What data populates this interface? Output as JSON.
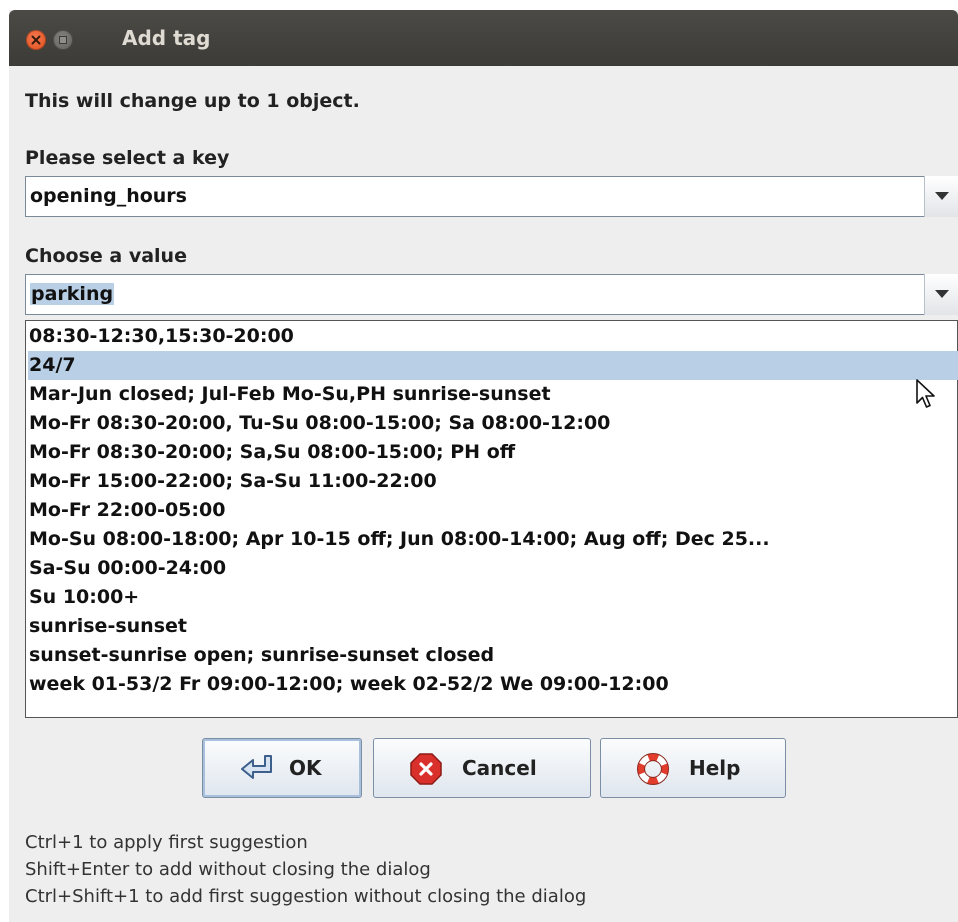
{
  "window": {
    "title": "Add tag"
  },
  "info_text": "This will change up to 1 object.",
  "key_section": {
    "label": "Please select a key",
    "value": "opening_hours"
  },
  "value_section": {
    "label": "Choose a value",
    "value": "parking"
  },
  "suggestions": [
    "08:30-12:30,15:30-20:00",
    "24/7",
    "Mar-Jun closed; Jul-Feb Mo-Su,PH sunrise-sunset",
    "Mo-Fr 08:30-20:00, Tu-Su 08:00-15:00; Sa 08:00-12:00",
    "Mo-Fr 08:30-20:00; Sa,Su 08:00-15:00; PH off",
    "Mo-Fr 15:00-22:00; Sa-Su 11:00-22:00",
    "Mo-Fr 22:00-05:00",
    "Mo-Su 08:00-18:00; Apr 10-15 off; Jun 08:00-14:00; Aug off; Dec 25...",
    "Sa-Su 00:00-24:00",
    "Su 10:00+",
    "sunrise-sunset",
    "sunset-sunrise open; sunrise-sunset closed",
    "week 01-53/2 Fr 09:00-12:00; week 02-52/2 We 09:00-12:00"
  ],
  "highlighted_suggestion": "24/7",
  "buttons": {
    "ok": "OK",
    "cancel": "Cancel",
    "help": "Help"
  },
  "icons": {
    "ok": "return-arrow-icon",
    "cancel": "stop-sign-icon",
    "help": "lifebuoy-icon",
    "combo_arrow": "triangle-down-icon"
  },
  "hints": [
    "Ctrl+1 to apply first suggestion",
    "Shift+Enter to add without closing the dialog",
    "Ctrl+Shift+1 to add first suggestion without closing the dialog"
  ],
  "colors": {
    "titlebar": "#3c3b37",
    "close_button": "#df4b16",
    "selection": "#b8cfe5",
    "cancel_icon": "#d9302b"
  }
}
